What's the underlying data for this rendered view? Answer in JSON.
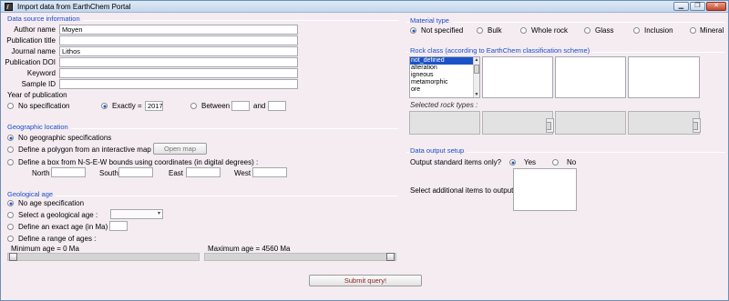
{
  "window": {
    "title": "Import data from EarthChem Portal",
    "buttons": {
      "minimize": "▁",
      "restore": "❐",
      "close": "✕"
    }
  },
  "data_source": {
    "section": "Data source information",
    "fields": [
      {
        "label": "Author name",
        "value": "Moyen"
      },
      {
        "label": "Publication title",
        "value": ""
      },
      {
        "label": "Journal name",
        "value": "Lithos"
      },
      {
        "label": "Publication DOI",
        "value": ""
      },
      {
        "label": "Keyword",
        "value": ""
      },
      {
        "label": "Sample ID",
        "value": ""
      }
    ],
    "year_label": "Year of publication",
    "year_options": {
      "none": "No specification",
      "exactly": "Exactly =",
      "exactly_value": "2017",
      "between": "Between",
      "and": "and",
      "selected": "exactly"
    }
  },
  "geo_location": {
    "section": "Geographic location",
    "opt_none": "No geographic specifications",
    "opt_polygon": "Define a polygon from an interactive map :",
    "open_map": "Open map",
    "opt_box": "Define a box from N-S-E-W bounds using coordinates (in digital degrees) :",
    "north": "North",
    "south": "South",
    "east": "East",
    "west": "West",
    "selected": "none"
  },
  "geo_age": {
    "section": "Geological age",
    "opt_none": "No age specification",
    "opt_geological": "Select a geological age :",
    "opt_exact": "Define an exact age (in Ma) :",
    "opt_range": "Define a range of ages :",
    "min_label": "Minimum age = 0 Ma",
    "max_label": "Maximum age = 4560 Ma",
    "min_slider_fraction": 0,
    "max_slider_fraction": 1,
    "selected": "none"
  },
  "submit": "Submit query!",
  "material": {
    "section": "Material type",
    "options": [
      "Not specified",
      "Bulk",
      "Whole rock",
      "Glass",
      "Inclusion",
      "Mineral"
    ],
    "selected": "Not specified"
  },
  "rock_class": {
    "section": "Rock class (according to EarthChem classification scheme)",
    "items": [
      "not_defined",
      "alteration",
      "igneous",
      "metamorphic",
      "ore"
    ],
    "selected": "not_defined",
    "selected_label": "Selected rock types :"
  },
  "output": {
    "section": "Data output setup",
    "standard_label": "Output standard items only?",
    "yes": "Yes",
    "no": "No",
    "selected": "Yes",
    "additional_label": "Select additional items to output :"
  }
}
